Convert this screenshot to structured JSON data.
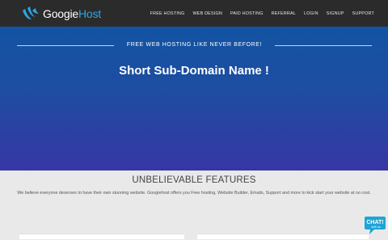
{
  "brand": {
    "name_part1": "Googie",
    "name_part2": "Host",
    "accent": "#2aa7e8"
  },
  "nav": {
    "items": [
      "FREE HOSTING",
      "WEB DESIGN",
      "PAID HOSTING",
      "REFERRAL",
      "LOGIN",
      "SIGNUP",
      "SUPPORT"
    ]
  },
  "hero": {
    "tagline": "FREE WEB HOSTING LIKE NEVER BEFORE!",
    "headline": "Short Sub-Domain Name !"
  },
  "features": {
    "title": "UNBELIEVABLE FEATURES",
    "description": "We believe everyone deserves to have their own stunning website. Googiehost offers you Free hosting, Website Builder, Emails, Support and more to kick start your website at no cost."
  },
  "chat": {
    "label_main": "CHAT!",
    "label_sub": "with us",
    "icon": "chat-bubble-icon"
  },
  "colors": {
    "navbar": "#2b2b2b",
    "hero_top": "#1253a3",
    "hero_bottom": "#3736a5",
    "features_bg": "#e9e9e9"
  }
}
